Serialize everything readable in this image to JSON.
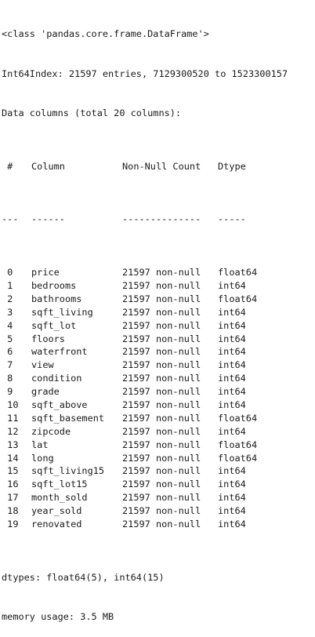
{
  "info": {
    "class_line": "<class 'pandas.core.frame.DataFrame'>",
    "index_line": "Int64Index: 21597 entries, 7129300520 to 1523300157",
    "columns_line": "Data columns (total 20 columns):",
    "header": {
      "idx": " #",
      "column": "Column",
      "count": "Non-Null Count",
      "dtype": "Dtype"
    },
    "separator": {
      "idx": "---",
      "column": "------",
      "count": "--------------",
      "dtype": "-----"
    },
    "rows": [
      {
        "idx": " 0",
        "column": "price",
        "count": "21597 non-null",
        "dtype": "float64"
      },
      {
        "idx": " 1",
        "column": "bedrooms",
        "count": "21597 non-null",
        "dtype": "int64"
      },
      {
        "idx": " 2",
        "column": "bathrooms",
        "count": "21597 non-null",
        "dtype": "float64"
      },
      {
        "idx": " 3",
        "column": "sqft_living",
        "count": "21597 non-null",
        "dtype": "int64"
      },
      {
        "idx": " 4",
        "column": "sqft_lot",
        "count": "21597 non-null",
        "dtype": "int64"
      },
      {
        "idx": " 5",
        "column": "floors",
        "count": "21597 non-null",
        "dtype": "int64"
      },
      {
        "idx": " 6",
        "column": "waterfront",
        "count": "21597 non-null",
        "dtype": "int64"
      },
      {
        "idx": " 7",
        "column": "view",
        "count": "21597 non-null",
        "dtype": "int64"
      },
      {
        "idx": " 8",
        "column": "condition",
        "count": "21597 non-null",
        "dtype": "int64"
      },
      {
        "idx": " 9",
        "column": "grade",
        "count": "21597 non-null",
        "dtype": "int64"
      },
      {
        "idx": " 10",
        "column": "sqft_above",
        "count": "21597 non-null",
        "dtype": "int64"
      },
      {
        "idx": " 11",
        "column": "sqft_basement",
        "count": "21597 non-null",
        "dtype": "float64"
      },
      {
        "idx": " 12",
        "column": "zipcode",
        "count": "21597 non-null",
        "dtype": "int64"
      },
      {
        "idx": " 13",
        "column": "lat",
        "count": "21597 non-null",
        "dtype": "float64"
      },
      {
        "idx": " 14",
        "column": "long",
        "count": "21597 non-null",
        "dtype": "float64"
      },
      {
        "idx": " 15",
        "column": "sqft_living15",
        "count": "21597 non-null",
        "dtype": "int64"
      },
      {
        "idx": " 16",
        "column": "sqft_lot15",
        "count": "21597 non-null",
        "dtype": "int64"
      },
      {
        "idx": " 17",
        "column": "month_sold",
        "count": "21597 non-null",
        "dtype": "int64"
      },
      {
        "idx": " 18",
        "column": "year_sold",
        "count": "21597 non-null",
        "dtype": "int64"
      },
      {
        "idx": " 19",
        "column": "renovated",
        "count": "21597 non-null",
        "dtype": "int64"
      }
    ],
    "dtypes_line": "dtypes: float64(5), int64(15)",
    "memory_line": "memory usage: 3.5 MB"
  },
  "colors": {
    "text": "#1a1a1a",
    "background": "#ffffff"
  }
}
